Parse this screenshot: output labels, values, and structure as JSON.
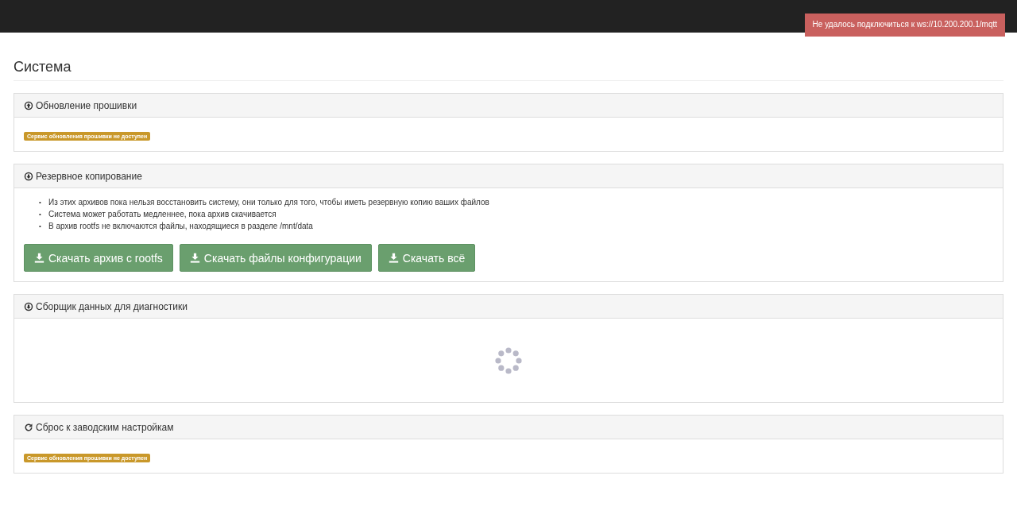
{
  "alert": {
    "text": "Не удалось подключиться к ws://10.200.200.1/mqtt"
  },
  "page_title": "Система",
  "panels": [
    {
      "kind": "badge",
      "title": "Обновление прошивки",
      "badge": "Сервис обновления прошивки не доступен"
    },
    {
      "kind": "backup",
      "title": "Резервное копирование",
      "notes": [
        {
          "bullet": "•",
          "text": "Из этих архивов пока нельзя восстановить систему, они только для того, чтобы иметь резервную копию ваших файлов"
        },
        {
          "bullet": "•",
          "text": "Система может работать медленнее, пока архив скачивается"
        },
        {
          "bullet": "•",
          "text": "В архив rootfs не включаются файлы, находящиеся в разделе /mnt/data"
        }
      ],
      "buttons": [
        "Скачать архив с rootfs",
        "Скачать файлы конфигурации",
        "Скачать всё"
      ]
    },
    {
      "kind": "loading",
      "title": "Сборщик данных для диагностики"
    },
    {
      "kind": "badge",
      "title": "Сброс к заводским настройкам",
      "badge": "Сервис обновления прошивки не доступен"
    }
  ]
}
